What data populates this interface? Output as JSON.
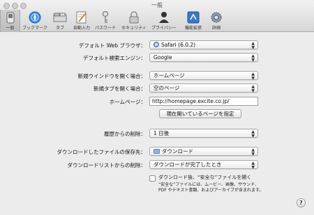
{
  "window": {
    "title": "一般"
  },
  "toolbar": {
    "items": [
      {
        "label": "一般",
        "icon": "general-switch-icon"
      },
      {
        "label": "ブックマーク",
        "icon": "globe-icon"
      },
      {
        "label": "タブ",
        "icon": "tabs-icon"
      },
      {
        "label": "自動入力",
        "icon": "pencil-pad-icon"
      },
      {
        "label": "パスワード",
        "icon": "key-icon"
      },
      {
        "label": "セキュリティ",
        "icon": "lock-icon"
      },
      {
        "label": "プライバシー",
        "icon": "person-icon"
      },
      {
        "label": "機能拡張",
        "icon": "puzzle-icon"
      },
      {
        "label": "詳細",
        "icon": "gear-icon"
      }
    ]
  },
  "form": {
    "default_browser": {
      "label": "デフォルト Web ブラウザ：",
      "value": "Safari (6.0.2)"
    },
    "default_search": {
      "label": "デフォルト検索エンジン：",
      "value": "Google"
    },
    "new_window": {
      "label": "新規ウインドウを開く場合：",
      "value": "ホームページ"
    },
    "new_tab": {
      "label": "新規タブを開く場合：",
      "value": "空のページ"
    },
    "homepage": {
      "label": "ホームページ：",
      "value": "http://homepage.excite.co.jp/"
    },
    "set_current_button": "現在開いているページを指定",
    "history_remove": {
      "label": "履歴からの削除：",
      "value": "1 日後"
    },
    "download_location": {
      "label": "ダウンロードしたファイルの保存先：",
      "value": "ダウンロード"
    },
    "download_list_remove": {
      "label": "ダウンロードリストからの削除：",
      "value": "ダウンロードが完了したとき"
    },
    "open_safe_files": {
      "label": "ダウンロード後、“安全な”ファイルを開く",
      "note_line1": "“安全な”ファイルには、ムービー、画像、サウンド、",
      "note_line2": "PDF やテキスト書類、およびアーカイブが含まれます。",
      "checked": false
    }
  },
  "help_label": "?"
}
